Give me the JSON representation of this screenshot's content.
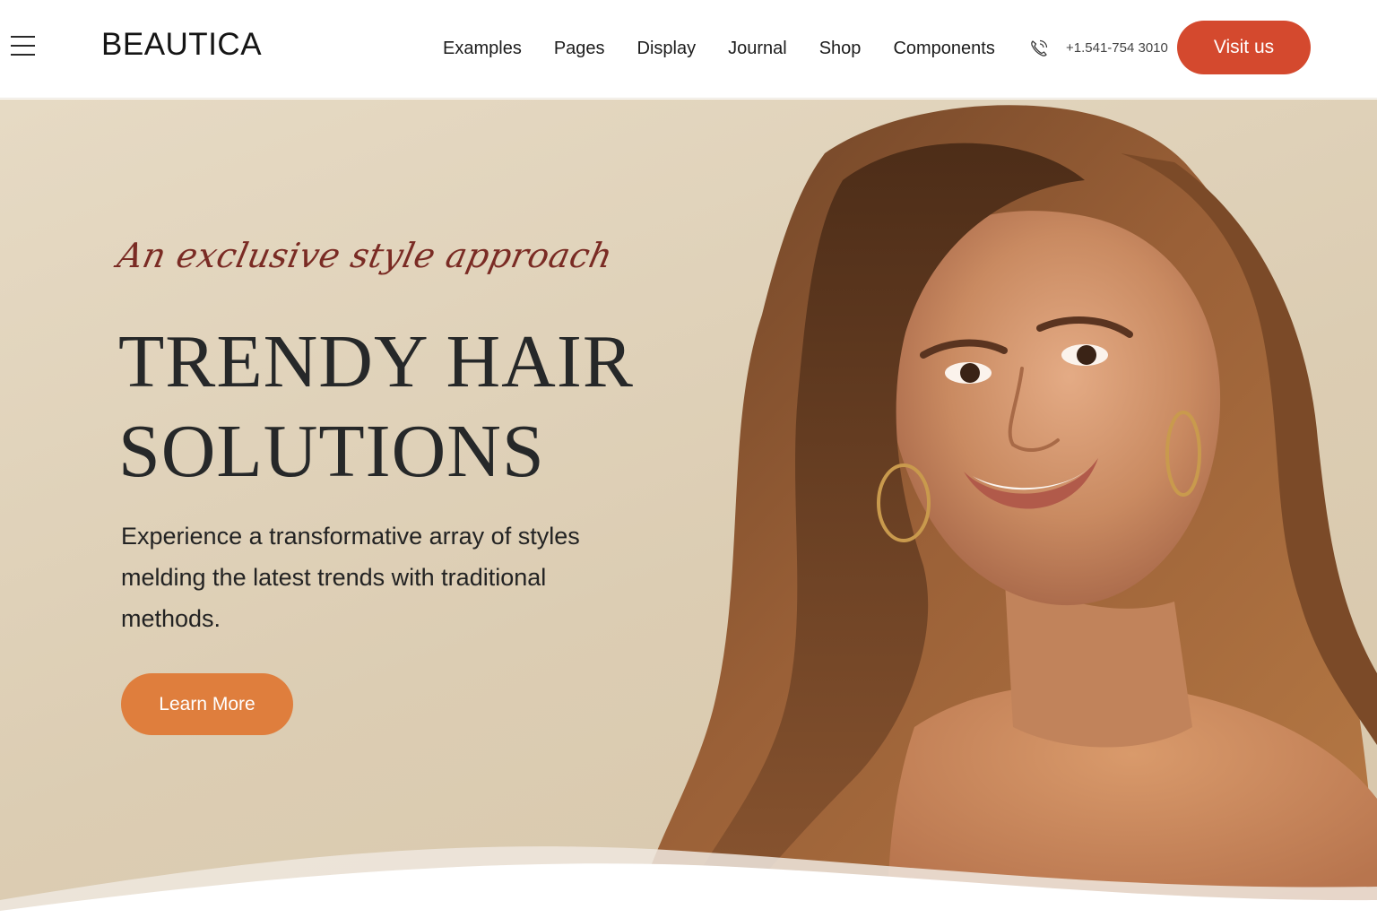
{
  "header": {
    "logo": "BEAUTICA",
    "nav": [
      "Examples",
      "Pages",
      "Display",
      "Journal",
      "Shop",
      "Components"
    ],
    "phone": "+1.541-754 3010",
    "cta_label": "Visit us"
  },
  "hero": {
    "script_tagline": "An exclusive style approach",
    "headline_line1": "TRENDY HAIR",
    "headline_line2": "SOLUTIONS",
    "description": "Experience a transformative array of styles melding the latest trends with traditional methods.",
    "button_label": "Learn More"
  },
  "colors": {
    "accent": "#d4492e",
    "button": "#df7e3d",
    "hero_bg": "#dfd1b9",
    "script": "#7a2b24"
  },
  "icons": [
    "hamburger-menu-icon",
    "phone-icon"
  ]
}
